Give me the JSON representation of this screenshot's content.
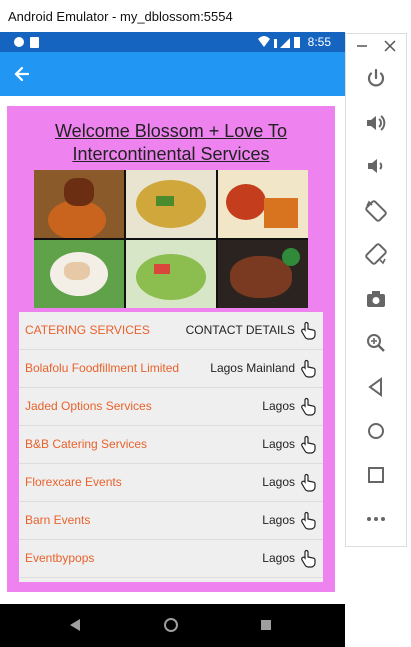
{
  "window": {
    "title": "Android Emulator - my_dblossom:5554"
  },
  "status_bar": {
    "time": "8:55"
  },
  "app_bar": {
    "back_icon": "arrow-left-icon"
  },
  "page": {
    "welcome_line1": "Welcome Blossom + Love To",
    "welcome_line2": "Intercontinental Services",
    "background_color": "#ee82ee",
    "food_images": [
      "jollof-rice-chicken",
      "fried-rice",
      "rice-and-fish",
      "salad-plate",
      "vegetable-salad",
      "grilled-meat"
    ]
  },
  "list": {
    "header": {
      "label": "CATERING SERVICES",
      "value": "CONTACT DETAILS"
    },
    "items": [
      {
        "name": "Bolafolu Foodfillment Limited",
        "location": "Lagos Mainland"
      },
      {
        "name": "Jaded Options Services",
        "location": "Lagos"
      },
      {
        "name": "B&B Catering Services",
        "location": "Lagos"
      },
      {
        "name": "Florexcare Events",
        "location": "Lagos"
      },
      {
        "name": "Barn Events",
        "location": "Lagos"
      },
      {
        "name": "Eventbypops",
        "location": "Lagos"
      }
    ],
    "accent_color": "#e8622c"
  },
  "nav_bar": {
    "icons": [
      "back-triangle-icon",
      "home-circle-icon",
      "recents-square-icon"
    ]
  },
  "emulator_side": {
    "icons": [
      "minimize-icon",
      "close-icon",
      "power-icon",
      "volume-up-icon",
      "volume-down-icon",
      "rotate-left-icon",
      "rotate-right-icon",
      "camera-icon",
      "zoom-icon",
      "back-icon",
      "home-icon",
      "overview-icon",
      "more-icon"
    ]
  }
}
